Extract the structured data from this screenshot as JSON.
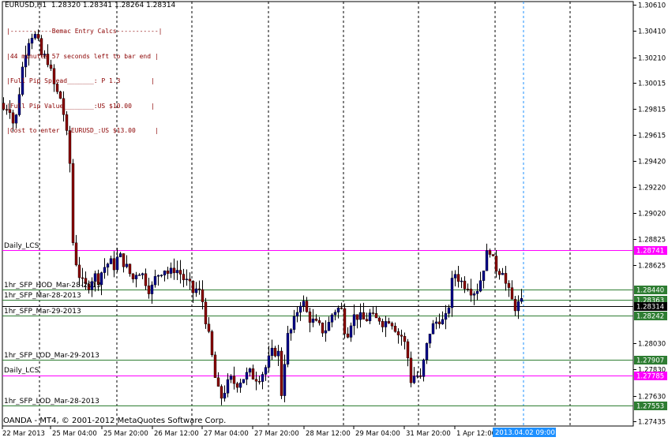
{
  "symbol_header": "EURUSD,H1  1.28320 1.28341 1.28264 1.28314",
  "copyright": "OANDA - MT4, © 2001-2012 MetaQuotes Software Corp.",
  "info_panel": [
    "|-----------Bemac Entry Calcs-----------|",
    "|44 minutes 57 seconds left to bar end |",
    "|Full Pip Spread_______: P 1.3        |",
    "|Full Pip Value________:US $10.00     |",
    "|Cost to enter  _EURUSD_:US $13.00     |"
  ],
  "colors": {
    "background": "#ffffff",
    "candle_up": "#00008b",
    "candle_down": "#8b0000",
    "wick": "#000000",
    "daily_line": "#ff00ff",
    "sfp_line": "#2e7d32",
    "current_price": "#000000",
    "date_tag": "#1e90ff"
  },
  "chart_data": {
    "type": "candlestick",
    "title": "EURUSD,H1",
    "ohlc_header": [
      1.2832,
      1.28341,
      1.28264,
      1.28314
    ],
    "ylim": [
      1.27435,
      1.3061
    ],
    "y_ticks": [
      "1.30610",
      "1.30410",
      "1.30210",
      "1.30015",
      "1.29815",
      "1.29615",
      "1.29420",
      "1.29220",
      "1.29020",
      "1.28825",
      "1.28625",
      "1.28030",
      "1.27830",
      "1.27630",
      "1.27435"
    ],
    "x_tick_labels": [
      "22 Mar 2013",
      "25 Mar 04:00",
      "25 Mar 20:00",
      "26 Mar 12:00",
      "27 Mar 04:00",
      "27 Mar 20:00",
      "28 Mar 12:00",
      "29 Mar 04:00",
      "31 Mar 20:00",
      "1 Apr 12:00"
    ],
    "current_time_label": "2013.04.02 09:00",
    "horizontal_levels": [
      {
        "label": "Daily_LCS",
        "price": 1.28741,
        "tag": "1.28741",
        "kind": "daily"
      },
      {
        "label": "1hr_SFP_HOD_Mar-28-2013",
        "price": 1.2844,
        "tag": "1.28440",
        "kind": "sfp"
      },
      {
        "label": "1hr_SFP_Mar-28-2013",
        "price": 1.28363,
        "tag": "1.28363",
        "kind": "sfp"
      },
      {
        "label": "",
        "price": 1.28314,
        "tag": "1.28314",
        "kind": "current"
      },
      {
        "label": "1hr_SFP_Mar-29-2013",
        "price": 1.28242,
        "tag": "1.28242",
        "kind": "sfp"
      },
      {
        "label": "1hr_SFP_LOD_Mar-29-2013",
        "price": 1.27907,
        "tag": "1.27907",
        "kind": "sfp"
      },
      {
        "label": "Daily_LCS",
        "price": 1.27785,
        "tag": "1.27785",
        "kind": "daily"
      },
      {
        "label": "1hr_SFP_LOD_Mar-28-2013",
        "price": 1.27553,
        "tag": "1.27553",
        "kind": "sfp"
      }
    ],
    "close_path": [
      [
        0,
        1.2986
      ],
      [
        6,
        1.2979
      ],
      [
        10,
        1.2988
      ],
      [
        18,
        1.2966
      ],
      [
        24,
        1.2995
      ],
      [
        30,
        1.3022
      ],
      [
        36,
        1.3035
      ],
      [
        42,
        1.304
      ],
      [
        48,
        1.3031
      ],
      [
        54,
        1.3018
      ],
      [
        58,
        1.3024
      ],
      [
        64,
        1.3009
      ],
      [
        70,
        1.2995
      ],
      [
        76,
        1.299
      ],
      [
        82,
        1.2972
      ],
      [
        86,
        1.295
      ],
      [
        90,
        1.293
      ],
      [
        92,
        1.288
      ],
      [
        96,
        1.2865
      ],
      [
        100,
        1.2855
      ],
      [
        106,
        1.2845
      ],
      [
        112,
        1.2848
      ],
      [
        118,
        1.2855
      ],
      [
        124,
        1.2852
      ],
      [
        130,
        1.286
      ],
      [
        138,
        1.2865
      ],
      [
        144,
        1.2862
      ],
      [
        150,
        1.287
      ],
      [
        156,
        1.2865
      ],
      [
        162,
        1.2858
      ],
      [
        168,
        1.2852
      ],
      [
        174,
        1.286
      ],
      [
        180,
        1.2855
      ],
      [
        186,
        1.2848
      ],
      [
        190,
        1.2842
      ],
      [
        196,
        1.2852
      ],
      [
        202,
        1.2858
      ],
      [
        208,
        1.286
      ],
      [
        214,
        1.2855
      ],
      [
        220,
        1.286
      ],
      [
        226,
        1.2858
      ],
      [
        232,
        1.2852
      ],
      [
        238,
        1.2848
      ],
      [
        244,
        1.2842
      ],
      [
        250,
        1.2845
      ],
      [
        256,
        1.2835
      ],
      [
        262,
        1.2815
      ],
      [
        266,
        1.28
      ],
      [
        270,
        1.2785
      ],
      [
        274,
        1.2768
      ],
      [
        280,
        1.2762
      ],
      [
        286,
        1.277
      ],
      [
        292,
        1.2775
      ],
      [
        298,
        1.2772
      ],
      [
        304,
        1.2775
      ],
      [
        310,
        1.2778
      ],
      [
        316,
        1.278
      ],
      [
        322,
        1.2777
      ],
      [
        328,
        1.2778
      ],
      [
        334,
        1.2782
      ],
      [
        340,
        1.279
      ],
      [
        346,
        1.2798
      ],
      [
        352,
        1.2795
      ],
      [
        356,
        1.2765
      ],
      [
        360,
        1.279
      ],
      [
        364,
        1.2808
      ],
      [
        370,
        1.2815
      ],
      [
        376,
        1.2828
      ],
      [
        382,
        1.2838
      ],
      [
        386,
        1.2828
      ],
      [
        392,
        1.2822
      ],
      [
        398,
        1.2818
      ],
      [
        404,
        1.2815
      ],
      [
        410,
        1.2812
      ],
      [
        416,
        1.2818
      ],
      [
        420,
        1.2825
      ],
      [
        426,
        1.283
      ],
      [
        432,
        1.2828
      ],
      [
        438,
        1.2808
      ],
      [
        444,
        1.282
      ],
      [
        450,
        1.2825
      ],
      [
        456,
        1.2822
      ],
      [
        462,
        1.282
      ],
      [
        468,
        1.2825
      ],
      [
        474,
        1.282
      ],
      [
        480,
        1.2822
      ],
      [
        486,
        1.2818
      ],
      [
        492,
        1.2822
      ],
      [
        498,
        1.2818
      ],
      [
        504,
        1.281
      ],
      [
        510,
        1.2808
      ],
      [
        516,
        1.2792
      ],
      [
        520,
        1.2775
      ],
      [
        526,
        1.278
      ],
      [
        532,
        1.2775
      ],
      [
        538,
        1.2795
      ],
      [
        544,
        1.2812
      ],
      [
        550,
        1.2818
      ],
      [
        556,
        1.2822
      ],
      [
        562,
        1.2818
      ],
      [
        566,
        1.2825
      ],
      [
        570,
        1.284
      ],
      [
        574,
        1.2858
      ],
      [
        580,
        1.2853
      ],
      [
        586,
        1.2848
      ],
      [
        592,
        1.2848
      ],
      [
        598,
        1.2842
      ],
      [
        604,
        1.2845
      ],
      [
        610,
        1.2855
      ],
      [
        614,
        1.2868
      ],
      [
        620,
        1.2875
      ],
      [
        624,
        1.2865
      ],
      [
        630,
        1.2858
      ],
      [
        636,
        1.286
      ],
      [
        640,
        1.2848
      ],
      [
        646,
        1.2838
      ],
      [
        650,
        1.2832
      ],
      [
        654,
        1.283
      ],
      [
        658,
        1.2835
      ],
      [
        662,
        1.2831
      ]
    ]
  }
}
